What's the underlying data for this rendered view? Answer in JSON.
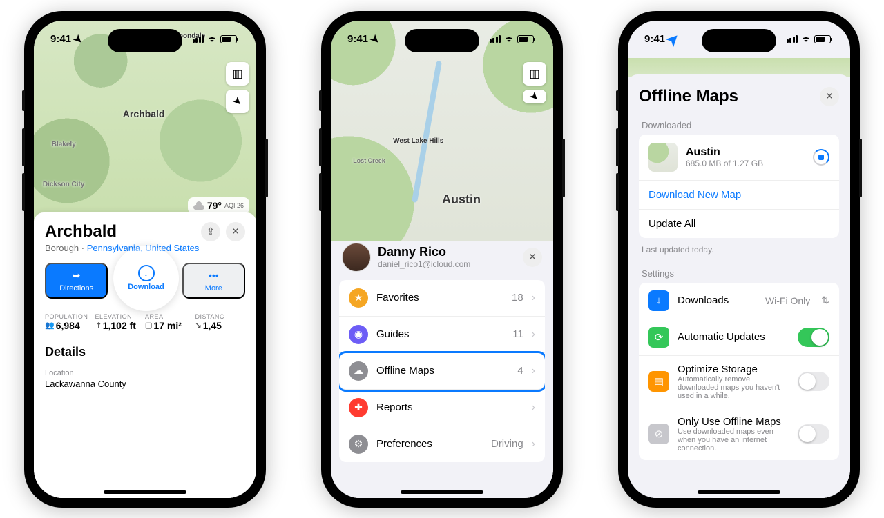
{
  "status": {
    "time": "9:41"
  },
  "p1": {
    "weather": {
      "temp": "79°",
      "aqi": "AQI 26"
    },
    "map_labels": {
      "place": "Archbald",
      "carbondale": "Carbondale",
      "blakely": "Blakely",
      "dickson": "Dickson City"
    },
    "title": "Archbald",
    "subtitle_type": "Borough",
    "subtitle_sep": " · ",
    "subtitle_link": "Pennsylvania, United States",
    "actions": {
      "directions": "Directions",
      "download": "Download",
      "more": "More"
    },
    "stats": {
      "population": {
        "label": "POPULATION",
        "value": "6,984"
      },
      "elevation": {
        "label": "ELEVATION",
        "value": "1,102 ft"
      },
      "area": {
        "label": "AREA",
        "value": "17 mi²"
      },
      "distance": {
        "label": "DISTANC",
        "value": "1,45"
      }
    },
    "details_title": "Details",
    "details": {
      "location_lbl": "Location",
      "location_val": "Lackawanna County"
    }
  },
  "p2": {
    "map_labels": {
      "austin": "Austin",
      "westlake": "West Lake Hills",
      "lostcreek": "Lost Creek"
    },
    "profile": {
      "name": "Danny Rico",
      "email": "daniel_rico1@icloud.com"
    },
    "rows": {
      "favorites": {
        "label": "Favorites",
        "count": "18"
      },
      "guides": {
        "label": "Guides",
        "count": "11"
      },
      "offline": {
        "label": "Offline Maps",
        "count": "4"
      },
      "reports": {
        "label": "Reports",
        "count": ""
      },
      "preferences": {
        "label": "Preferences",
        "trail": "Driving"
      }
    }
  },
  "p3": {
    "title": "Offline Maps",
    "downloaded_lbl": "Downloaded",
    "austin": {
      "title": "Austin",
      "sub": "685.0 MB of 1.27 GB"
    },
    "download_new": "Download New Map",
    "update_all": "Update All",
    "last_updated": "Last updated today.",
    "settings_lbl": "Settings",
    "settings": {
      "downloads": {
        "title": "Downloads",
        "trail": "Wi-Fi Only"
      },
      "auto": {
        "title": "Automatic Updates"
      },
      "optimize": {
        "title": "Optimize Storage",
        "sub": "Automatically remove downloaded maps you haven't used in a while."
      },
      "only": {
        "title": "Only Use Offline Maps",
        "sub": "Use downloaded maps even when you have an internet connection."
      }
    }
  }
}
